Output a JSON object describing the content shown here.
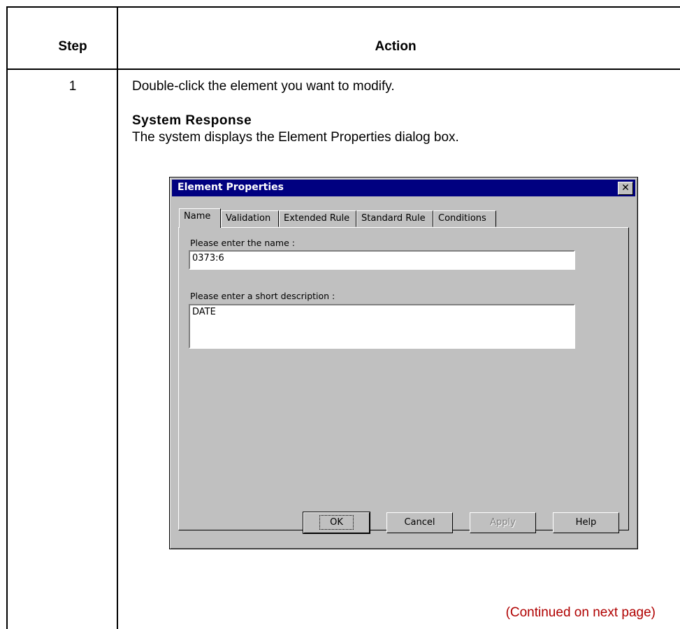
{
  "table": {
    "header_step": "Step",
    "header_action": "Action",
    "step_number": "1",
    "action_text": "Double-click the element you want to modify.",
    "system_response_title": "System Response",
    "system_response_text": "The system displays the Element Properties dialog box.",
    "continued": "(Continued on next page)"
  },
  "dialog": {
    "title": "Element Properties",
    "close_symbol": "✕",
    "tabs": [
      {
        "label": "Name",
        "active": true
      },
      {
        "label": "Validation",
        "active": false
      },
      {
        "label": "Extended Rule",
        "active": false
      },
      {
        "label": "Standard Rule",
        "active": false
      },
      {
        "label": "Conditions",
        "active": false
      }
    ],
    "name_label": "Please enter the name :",
    "name_value": "0373:6",
    "desc_label": "Please enter a short description :",
    "desc_value": "DATE",
    "buttons": {
      "ok": "OK",
      "cancel": "Cancel",
      "apply": "Apply",
      "help": "Help"
    }
  },
  "colors": {
    "titlebar": "#000080",
    "continued_text": "#b00000",
    "dialog_face": "#c0c0c0"
  }
}
